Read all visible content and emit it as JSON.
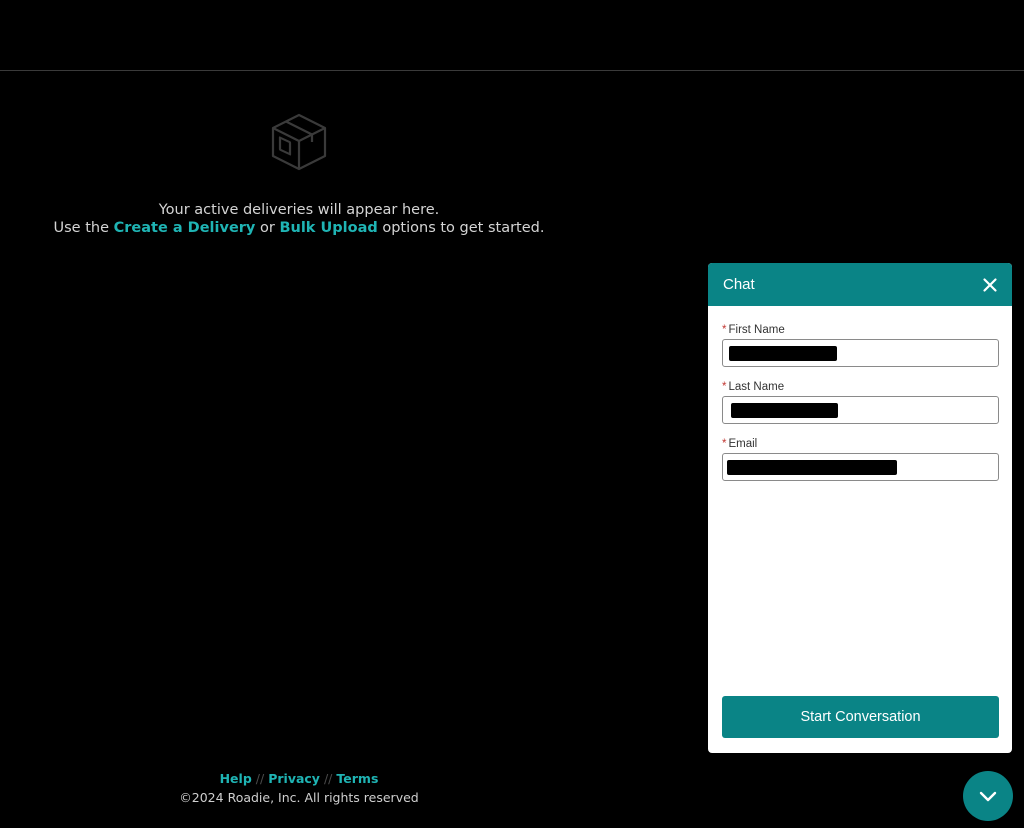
{
  "empty_state": {
    "line1": "Your active deliveries will appear here.",
    "line2_prefix": "Use the ",
    "create_link": "Create a Delivery",
    "line2_mid": " or ",
    "bulk_link": "Bulk Upload",
    "line2_suffix": " options to get started.",
    "icon": "box-icon"
  },
  "footer": {
    "help": "Help",
    "privacy": "Privacy",
    "terms": "Terms",
    "separator": "//",
    "copyright": "©2024 Roadie, Inc. All rights reserved"
  },
  "chat": {
    "title": "Chat",
    "required_marker": "*",
    "fields": [
      {
        "label": "First Name",
        "value": "[redacted]"
      },
      {
        "label": "Last Name",
        "value": "[redacted]"
      },
      {
        "label": "Email",
        "value": "[redacted]"
      }
    ],
    "start_button": "Start Conversation",
    "close_icon": "close-icon",
    "minimize_icon": "chevron-down-icon"
  },
  "colors": {
    "accent": "#1fb4b4",
    "chat_teal": "#0a8486",
    "background": "#000000"
  }
}
